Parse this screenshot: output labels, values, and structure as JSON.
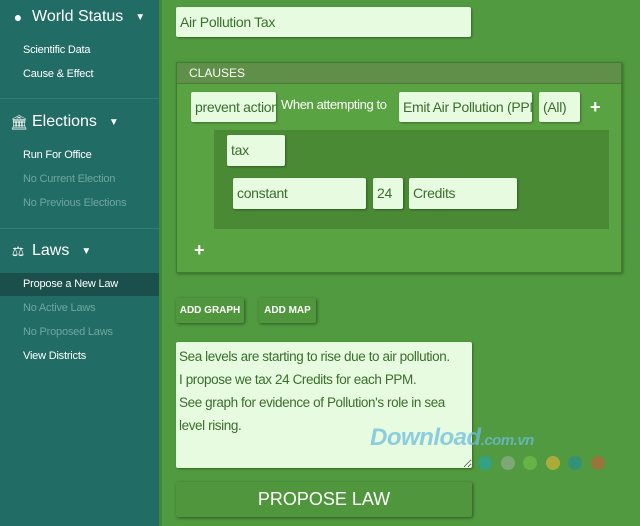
{
  "sidebar": {
    "sections": [
      {
        "title": "World Status",
        "icon": "globe-icon",
        "items": [
          {
            "label": "Scientific Data",
            "enabled": true
          },
          {
            "label": "Cause & Effect",
            "enabled": true
          }
        ]
      },
      {
        "title": "Elections",
        "icon": "institution-icon",
        "items": [
          {
            "label": "Run For Office",
            "enabled": true
          },
          {
            "label": "No Current Election",
            "enabled": false
          },
          {
            "label": "No Previous Elections",
            "enabled": false
          }
        ]
      },
      {
        "title": "Laws",
        "icon": "scales-icon",
        "items": [
          {
            "label": "Propose a New Law",
            "enabled": true,
            "active": true
          },
          {
            "label": "No Active Laws",
            "enabled": false
          },
          {
            "label": "No Proposed Laws",
            "enabled": false
          },
          {
            "label": "View Districts",
            "enabled": true
          }
        ]
      }
    ]
  },
  "form": {
    "title_value": "Air Pollution Tax",
    "clauses": {
      "header": "CLAUSES",
      "action": "prevent action",
      "condition_text": "When attempting to",
      "activity": "Emit Air Pollution (PPM)",
      "scope": "(All)",
      "effect": "tax",
      "amount_type": "constant",
      "amount": "24",
      "currency": "Credits",
      "add_symbol": "+"
    },
    "add_graph_label": "ADD GRAPH",
    "add_map_label": "ADD MAP",
    "description": "Sea levels are starting to rise due to air pollution.\nI propose we tax 24 Credits for each PPM.\nSee graph for evidence of Pollution's role in sea level rising.",
    "propose_label": "PROPOSE LAW"
  },
  "watermark": {
    "text": "Download",
    "suffix": ".com.vn",
    "dot_colors": [
      "#2aa39a",
      "#8fa98a",
      "#6fbb4a",
      "#c8b23a",
      "#2a8f8a",
      "#b06a3a"
    ]
  }
}
